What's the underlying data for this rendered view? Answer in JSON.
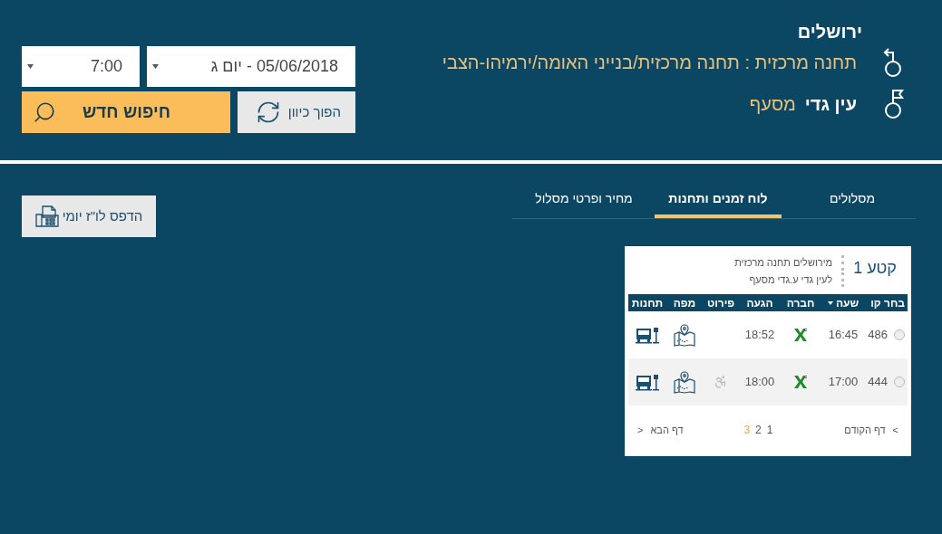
{
  "origin": {
    "city": "ירושלים",
    "station": "תחנה מרכזית : תחנה מרכזית/בנייני האומה/ירמיהו-הצבי"
  },
  "destination": {
    "city": "עין גדי",
    "station": "מסעף"
  },
  "date_field": {
    "value": "05/06/2018 - יום ג"
  },
  "time_field": {
    "value": "7:00"
  },
  "swap_button": "הפוך כיוון",
  "search_button": "חיפוש חדש",
  "print_button": "הדפס לו\"ז יומי",
  "tabs": [
    {
      "label": "מסלולים",
      "selected": false
    },
    {
      "label": "לוח זמנים ותחנות",
      "selected": true
    },
    {
      "label": "מחיר ופרטי מסלול",
      "selected": false
    }
  ],
  "segment": {
    "title": "קטע 1",
    "from": "מירושלים תחנה מרכזית",
    "to": "לעין גדי ע.גדי מסעף"
  },
  "table": {
    "columns": [
      {
        "label": "בחר קו",
        "sorted": false
      },
      {
        "label": "שעה",
        "sorted": true
      },
      {
        "label": "חברה",
        "sorted": false
      },
      {
        "label": "הגעה",
        "sorted": false
      },
      {
        "label": "פירוט",
        "sorted": false
      },
      {
        "label": "מפה",
        "sorted": false
      },
      {
        "label": "תחנות",
        "sorted": false
      }
    ],
    "rows": [
      {
        "selected": false,
        "line": "486",
        "departure": "16:45",
        "arrival": "18:52",
        "accessible": false
      },
      {
        "selected": false,
        "line": "444",
        "departure": "17:00",
        "arrival": "18:00",
        "accessible": true
      }
    ]
  },
  "pagination": {
    "previous": "דף הקודם",
    "previous_arrow": ">",
    "pages": [
      {
        "label": "1",
        "selected": false
      },
      {
        "label": "2",
        "selected": false
      },
      {
        "label": "3",
        "selected": true
      }
    ],
    "next": "דף הבא",
    "next_arrow": "<"
  }
}
